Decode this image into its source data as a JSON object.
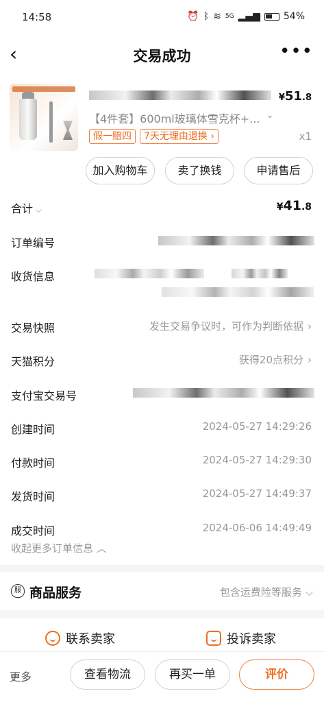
{
  "status_bar": {
    "time": "14:58",
    "battery": "54%",
    "signal": "5G"
  },
  "header": {
    "title": "交易成功",
    "back_icon": "‹",
    "more_icon": "•••"
  },
  "product": {
    "price_currency": "¥",
    "price_int": "51",
    "price_dec": ".8",
    "title": "【4件套】600ml玻璃体雪克杯+...",
    "badge_1": "假一赔四",
    "badge_2": "7天无理由退换 ›",
    "quantity": "x1"
  },
  "actions": {
    "add_to_cart": "加入购物车",
    "resell": "卖了换钱",
    "after_sale": "申请售后"
  },
  "total": {
    "label": "合计",
    "currency": "¥",
    "int": "41",
    "dec": ".8"
  },
  "rows": {
    "order_no_label": "订单编号",
    "shipping_label": "收货信息",
    "snapshot_label": "交易快照",
    "snapshot_value": "发生交易争议时，可作为判断依据",
    "points_label": "天猫积分",
    "points_value": "获得20点积分",
    "alipay_label": "支付宝交易号",
    "created_label": "创建时间",
    "created_value": "2024-05-27 14:29:26",
    "paid_label": "付款时间",
    "paid_value": "2024-05-27 14:29:30",
    "shipped_label": "发货时间",
    "shipped_value": "2024-05-27 14:49:37",
    "closed_label": "成交时间",
    "closed_value": "2024-06-06 14:49:49",
    "collapse": "收起更多订单信息"
  },
  "service": {
    "title": "商品服务",
    "value": "包含运费险等服务"
  },
  "contact": {
    "seller": "联系卖家",
    "complain": "投诉卖家"
  },
  "bottom": {
    "more": "更多",
    "logistics": "查看物流",
    "rebuy": "再买一单",
    "review": "评价"
  },
  "colors": {
    "accent": "#ef6d22"
  }
}
